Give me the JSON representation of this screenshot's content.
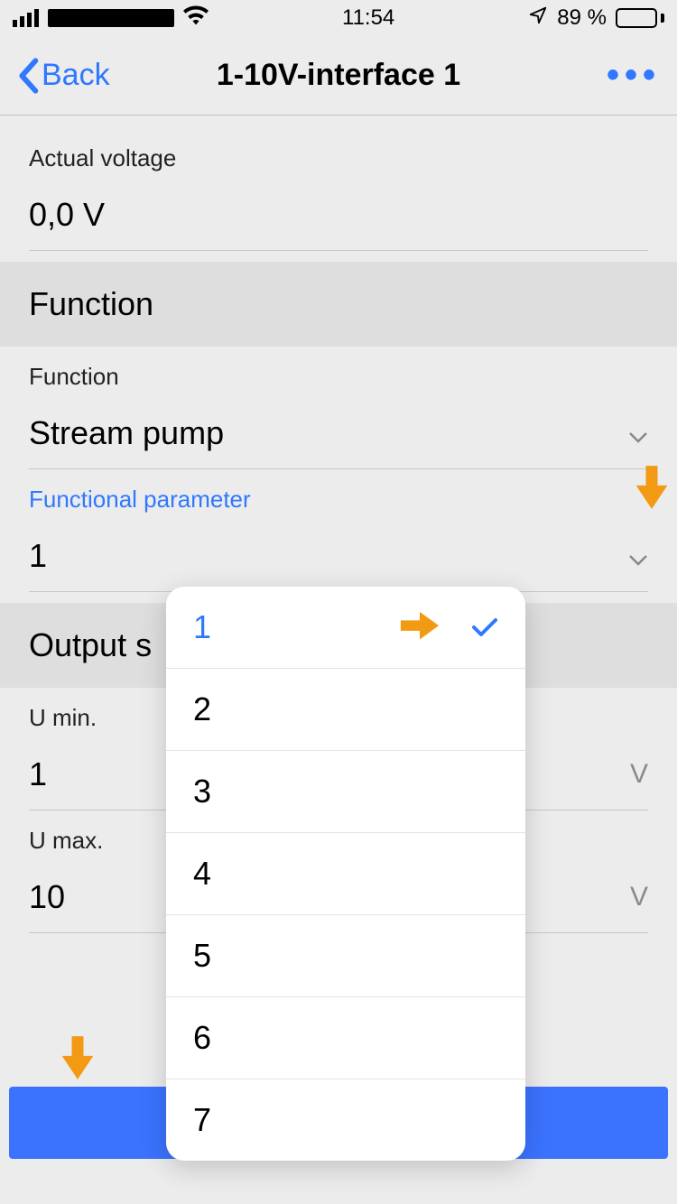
{
  "status": {
    "time": "11:54",
    "battery_pct": "89 %"
  },
  "nav": {
    "back_label": "Back",
    "title": "1-10V-interface 1",
    "more_label": "•••"
  },
  "fields": {
    "actual_voltage": {
      "label": "Actual voltage",
      "value": "0,0 V"
    },
    "function_header": "Function",
    "function": {
      "label": "Function",
      "value": "Stream pump"
    },
    "functional_parameter": {
      "label": "Functional parameter",
      "value": "1"
    },
    "output_header": "Output s",
    "u_min": {
      "label": "U min.",
      "value": "1",
      "unit": "V"
    },
    "u_max": {
      "label": "U max.",
      "value": "10",
      "unit": "V"
    }
  },
  "popover": {
    "selected": "1",
    "options": [
      "1",
      "2",
      "3",
      "4",
      "5",
      "6",
      "7"
    ]
  },
  "colors": {
    "accent": "#2f78ff",
    "annotation": "#f29a13"
  }
}
